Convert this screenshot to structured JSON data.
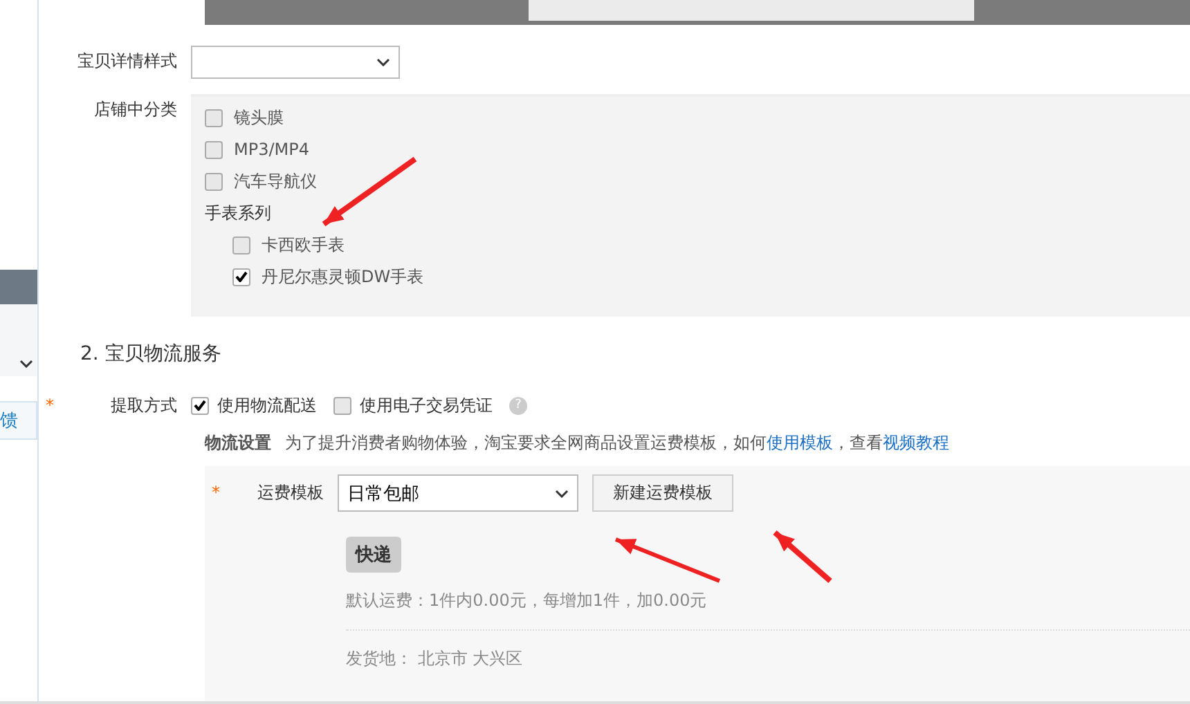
{
  "sidebar": {
    "feedback_label": "馈"
  },
  "detail_style": {
    "label": "宝贝详情样式"
  },
  "shop_category": {
    "label": "店铺中分类",
    "items": [
      {
        "kind": "check",
        "label": "镜头膜",
        "checked": false
      },
      {
        "kind": "check",
        "label": "MP3/MP4",
        "checked": false
      },
      {
        "kind": "check",
        "label": "汽车导航仪",
        "checked": false
      },
      {
        "kind": "group",
        "label": "手表系列",
        "children": [
          {
            "kind": "check",
            "label": "卡西欧手表",
            "checked": false
          },
          {
            "kind": "check",
            "label": "丹尼尔惠灵顿DW手表",
            "checked": true
          }
        ]
      }
    ]
  },
  "section_title": "2. 宝贝物流服务",
  "pickup": {
    "required_mark": "*",
    "label": "提取方式",
    "help": "?",
    "options": [
      {
        "label": "使用物流配送",
        "checked": true
      },
      {
        "label": "使用电子交易凭证",
        "checked": false
      }
    ]
  },
  "logistics_note": {
    "title": "物流设置",
    "text": "为了提升消费者购物体验，淘宝要求全网商品设置运费模板，如何",
    "link_1": "使用模板",
    "separator": "，查看",
    "link_2": "视频教程"
  },
  "freight": {
    "required_mark": "*",
    "label": "运费模板",
    "value": "日常包邮",
    "new_button": "新建运费模板",
    "tag": "快递",
    "default_fee": "默认运费：1件内0.00元，每增加1件，加0.00元",
    "origin_label": "发货地：",
    "origin": "北京市 大兴区"
  }
}
